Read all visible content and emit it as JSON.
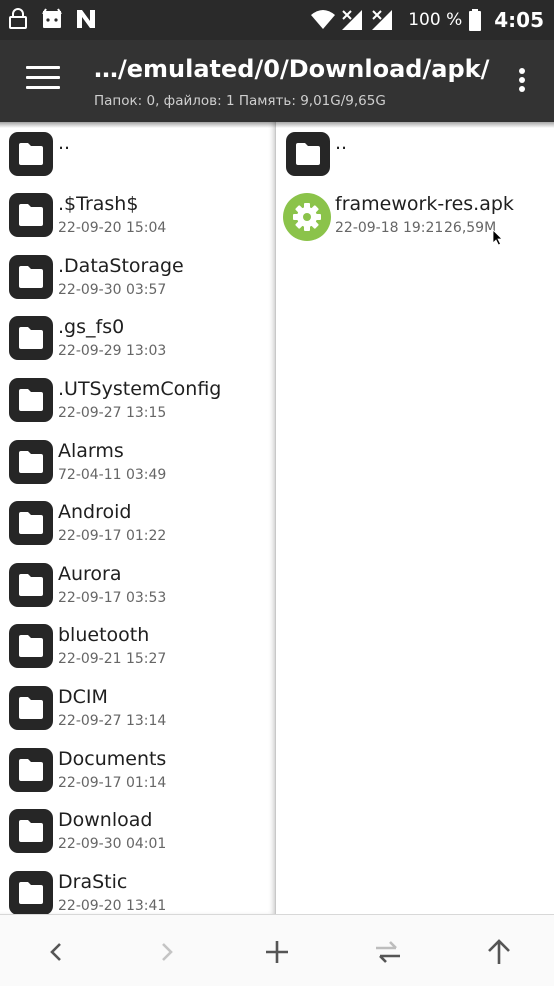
{
  "status_bar": {
    "battery": "100 %",
    "time": "4:05",
    "icons": [
      "lock-icon",
      "android-icon",
      "n-icon",
      "wifi-icon",
      "signal-icon",
      "signal-icon",
      "battery-icon"
    ]
  },
  "app_bar": {
    "path": "…/emulated/0/Download/apk/",
    "summary": "Папок: 0, файлов: 1  Память: 9,01G/9,65G"
  },
  "left_pane": {
    "items": [
      {
        "name": "..",
        "date": ""
      },
      {
        "name": ".$Trash$",
        "date": "22-09-20 15:04"
      },
      {
        "name": ".DataStorage",
        "date": "22-09-30 03:57"
      },
      {
        "name": ".gs_fs0",
        "date": "22-09-29 13:03"
      },
      {
        "name": ".UTSystemConfig",
        "date": "22-09-27 13:15"
      },
      {
        "name": "Alarms",
        "date": "72-04-11 03:49"
      },
      {
        "name": "Android",
        "date": "22-09-17 01:22"
      },
      {
        "name": "Aurora",
        "date": "22-09-17 03:53"
      },
      {
        "name": "bluetooth",
        "date": "22-09-21 15:27"
      },
      {
        "name": "DCIM",
        "date": "22-09-27 13:14"
      },
      {
        "name": "Documents",
        "date": "22-09-17 01:14"
      },
      {
        "name": "Download",
        "date": "22-09-30 04:01"
      },
      {
        "name": "DraStic",
        "date": "22-09-20 13:41"
      }
    ]
  },
  "right_pane": {
    "parent": {
      "name": ".."
    },
    "file": {
      "name": "framework-res.apk",
      "date": "22-09-18 19:21",
      "size": "26,59M"
    }
  },
  "colors": {
    "status_bar": "#2a2a2a",
    "app_bar": "#333333",
    "folder_icon": "#262626",
    "apk_icon": "#8bc34a"
  }
}
